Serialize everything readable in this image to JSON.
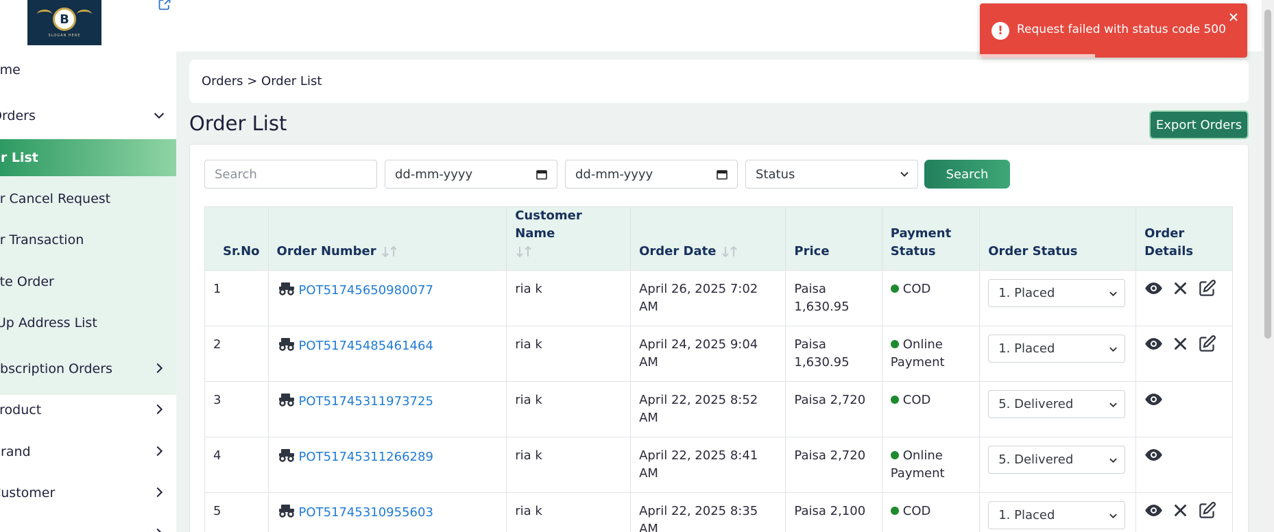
{
  "logo": {
    "letter": "B",
    "slogan": "SLOGAN HERE"
  },
  "sidebar": {
    "items": [
      {
        "label": "Home",
        "visible_label": "ome"
      },
      {
        "label": "Orders",
        "visible_label": "Orders"
      },
      {
        "label": "Order List",
        "visible_label": "er List"
      },
      {
        "label": "Order Cancel Request",
        "visible_label": "er Cancel Request"
      },
      {
        "label": "Order Transaction",
        "visible_label": "er Transaction"
      },
      {
        "label": "Create Order",
        "visible_label": "ate Order"
      },
      {
        "label": "Pick-Up Address List",
        "visible_label": "-Up Address List"
      },
      {
        "label": "Subscription Orders",
        "visible_label": "ubscription Orders"
      },
      {
        "label": "Product",
        "visible_label": "Product"
      },
      {
        "label": "Brand",
        "visible_label": "Brand"
      },
      {
        "label": "Customer",
        "visible_label": "Customer"
      }
    ]
  },
  "breadcrumb": {
    "text": "Orders > Order List"
  },
  "page": {
    "title": "Order List",
    "export_label": "Export Orders"
  },
  "filters": {
    "search_placeholder": "Search",
    "date_from": "dd-mm-yyyy",
    "date_to": "dd-mm-yyyy",
    "status_placeholder": "Status",
    "search_button": "Search"
  },
  "table": {
    "headers": {
      "sr": "Sr.No",
      "order_number": "Order Number",
      "customer_name": "Customer Name",
      "order_date": "Order Date",
      "price": "Price",
      "payment_status": "Payment Status",
      "order_status": "Order Status",
      "order_details": "Order Details"
    },
    "rows": [
      {
        "sr": "1",
        "order_number": "POT51745650980077",
        "customer": "ria k",
        "date": "April 26, 2025 7:02 AM",
        "price": "Paisa 1,630.95",
        "payment": "COD",
        "status": "1. Placed",
        "actions": [
          "view",
          "cancel",
          "edit"
        ]
      },
      {
        "sr": "2",
        "order_number": "POT51745485461464",
        "customer": "ria k",
        "date": "April 24, 2025 9:04 AM",
        "price": "Paisa 1,630.95",
        "payment": "Online Payment",
        "status": "1. Placed",
        "actions": [
          "view",
          "cancel",
          "edit"
        ]
      },
      {
        "sr": "3",
        "order_number": "POT51745311973725",
        "customer": "ria k",
        "date": "April 22, 2025 8:52 AM",
        "price": "Paisa 2,720",
        "payment": "COD",
        "status": "5. Delivered",
        "actions": [
          "view"
        ]
      },
      {
        "sr": "4",
        "order_number": "POT51745311266289",
        "customer": "ria k",
        "date": "April 22, 2025 8:41 AM",
        "price": "Paisa 2,720",
        "payment": "Online Payment",
        "status": "5. Delivered",
        "actions": [
          "view"
        ]
      },
      {
        "sr": "5",
        "order_number": "POT51745310955603",
        "customer": "ria k",
        "date": "April 22, 2025 8:35 AM",
        "price": "Paisa 2,100",
        "payment": "COD",
        "status": "1. Placed",
        "actions": [
          "view",
          "cancel",
          "edit"
        ]
      }
    ]
  },
  "toast": {
    "message": "Request failed with status code 500",
    "progress": 0.43
  },
  "colors": {
    "accent": "#237a5c",
    "link": "#1f7cd6",
    "error": "#e5473d",
    "paid_dot": "#1d8a2e"
  }
}
